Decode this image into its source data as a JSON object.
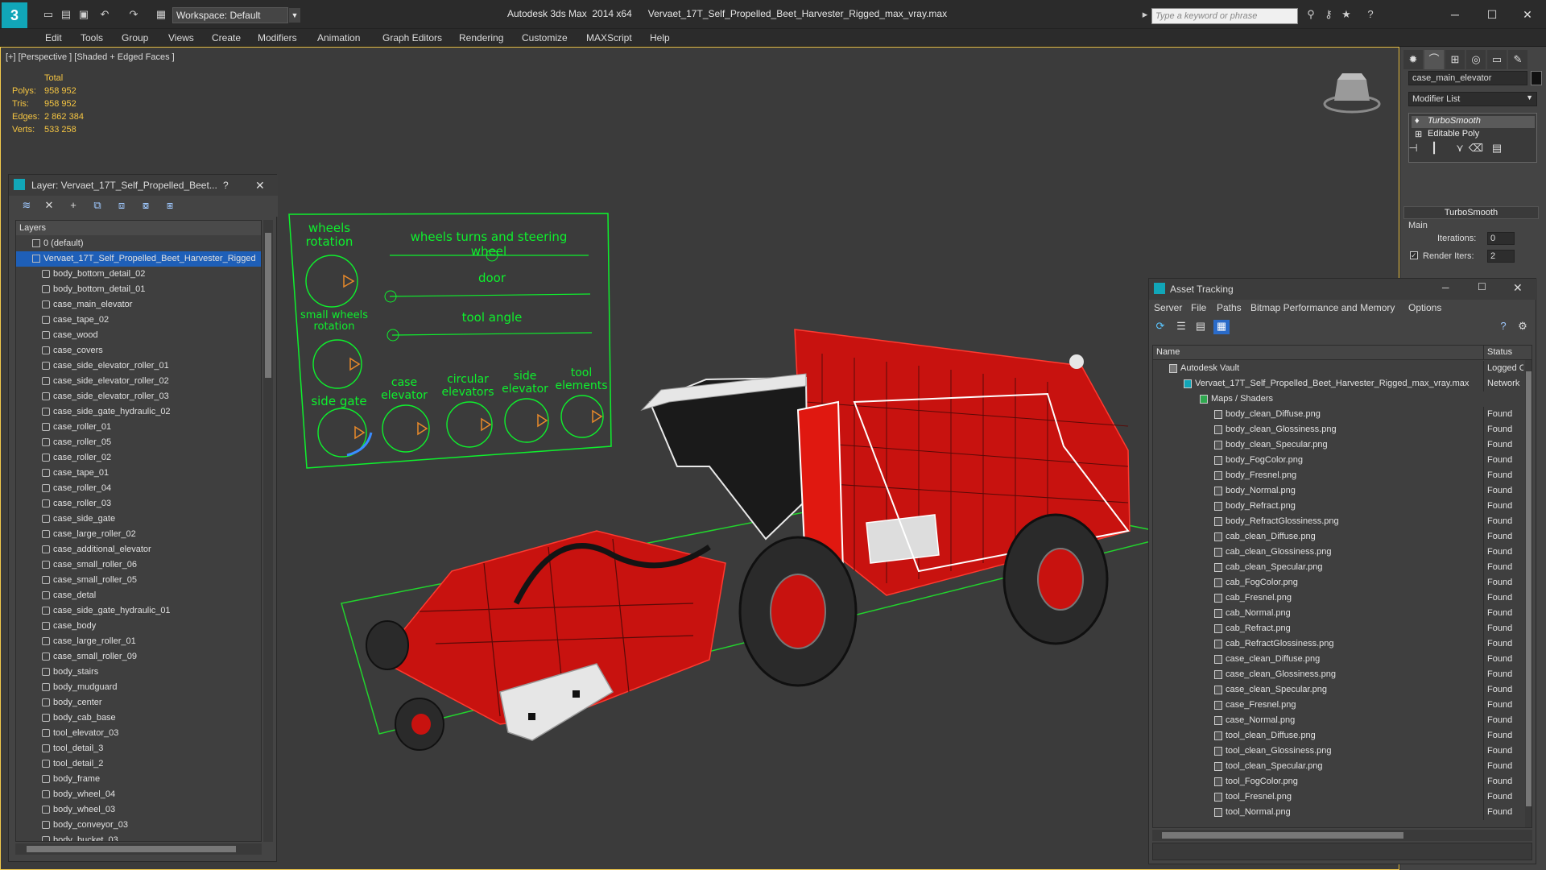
{
  "titlebar": {
    "app_logo": "3",
    "workspace": "Workspace: Default",
    "title": "Autodesk 3ds Max  2014 x64      Vervaet_17T_Self_Propelled_Beet_Harvester_Rigged_max_vray.max",
    "search_placeholder": "Type a keyword or phrase"
  },
  "menu": [
    "Edit",
    "Tools",
    "Group",
    "Views",
    "Create",
    "Modifiers",
    "Animation",
    "Graph Editors",
    "Rendering",
    "Customize",
    "MAXScript",
    "Help"
  ],
  "viewport": {
    "label": "[+] [Perspective ] [Shaded + Edged Faces ]",
    "stats": {
      "header": "Total",
      "rows": [
        {
          "k": "Polys:",
          "v": "958 952"
        },
        {
          "k": "Tris:",
          "v": "958 952"
        },
        {
          "k": "Edges:",
          "v": "2 862 384"
        },
        {
          "k": "Verts:",
          "v": "533 258"
        }
      ]
    },
    "rig": {
      "wheels_rotation": "wheels rotation",
      "wheels_turns": "wheels turns and steering wheel",
      "door": "door",
      "small_wheels": "small wheels rotation",
      "tool_angle": "tool angle",
      "side_gate": "side gate",
      "case_elevator": "case elevator",
      "circular_elevators": "circular elevators",
      "side_elevator": "side elevator",
      "tool_elements": "tool elements"
    }
  },
  "command_panel": {
    "object_name": "case_main_elevator",
    "modifier_list": "Modifier List",
    "stack": [
      "TurboSmooth",
      "Editable Poly"
    ],
    "rollout": "TurboSmooth",
    "group": "Main",
    "iterations_label": "Iterations:",
    "iterations_value": "0",
    "render_iters_label": "Render Iters:",
    "render_iters_value": "2"
  },
  "layer_panel": {
    "title": "Layer: Vervaet_17T_Self_Propelled_Beet...",
    "help": "?",
    "header": "Layers",
    "default_layer": "0 (default)",
    "active_layer": "Vervaet_17T_Self_Propelled_Beet_Harvester_Rigged",
    "items": [
      "body_bottom_detail_02",
      "body_bottom_detail_01",
      "case_main_elevator",
      "case_tape_02",
      "case_wood",
      "case_covers",
      "case_side_elevator_roller_01",
      "case_side_elevator_roller_02",
      "case_side_elevator_roller_03",
      "case_side_gate_hydraulic_02",
      "case_roller_01",
      "case_roller_05",
      "case_roller_02",
      "case_tape_01",
      "case_roller_04",
      "case_roller_03",
      "case_side_gate",
      "case_large_roller_02",
      "case_additional_elevator",
      "case_small_roller_06",
      "case_small_roller_05",
      "case_detal",
      "case_side_gate_hydraulic_01",
      "case_body",
      "case_large_roller_01",
      "case_small_roller_09",
      "body_stairs",
      "body_mudguard",
      "body_center",
      "body_cab_base",
      "tool_elevator_03",
      "tool_detail_3",
      "tool_detail_2",
      "body_frame",
      "body_wheel_04",
      "body_wheel_03",
      "body_conveyor_03",
      "body_bucket_03"
    ]
  },
  "asset_panel": {
    "title": "Asset Tracking",
    "menu": [
      "Server",
      "File",
      "Paths",
      "Bitmap Performance and Memory",
      "Options"
    ],
    "col_name": "Name",
    "col_status": "Status",
    "vault": {
      "name": "Autodesk Vault",
      "status": "Logged O"
    },
    "file": {
      "name": "Vervaet_17T_Self_Propelled_Beet_Harvester_Rigged_max_vray.max",
      "status": "Network"
    },
    "folder": "Maps / Shaders",
    "maps": [
      "body_clean_Diffuse.png",
      "body_clean_Glossiness.png",
      "body_clean_Specular.png",
      "body_FogColor.png",
      "body_Fresnel.png",
      "body_Normal.png",
      "body_Refract.png",
      "body_RefractGlossiness.png",
      "cab_clean_Diffuse.png",
      "cab_clean_Glossiness.png",
      "cab_clean_Specular.png",
      "cab_FogColor.png",
      "cab_Fresnel.png",
      "cab_Normal.png",
      "cab_Refract.png",
      "cab_RefractGlossiness.png",
      "case_clean_Diffuse.png",
      "case_clean_Glossiness.png",
      "case_clean_Specular.png",
      "case_Fresnel.png",
      "case_Normal.png",
      "tool_clean_Diffuse.png",
      "tool_clean_Glossiness.png",
      "tool_clean_Specular.png",
      "tool_FogColor.png",
      "tool_Fresnel.png",
      "tool_Normal.png"
    ],
    "found": "Found"
  },
  "colors": {
    "accent": "#11a6b8",
    "selection": "#1e5fb8",
    "stats": "#f5c542",
    "rig": "#0ef02d",
    "model": "#e0201c"
  }
}
